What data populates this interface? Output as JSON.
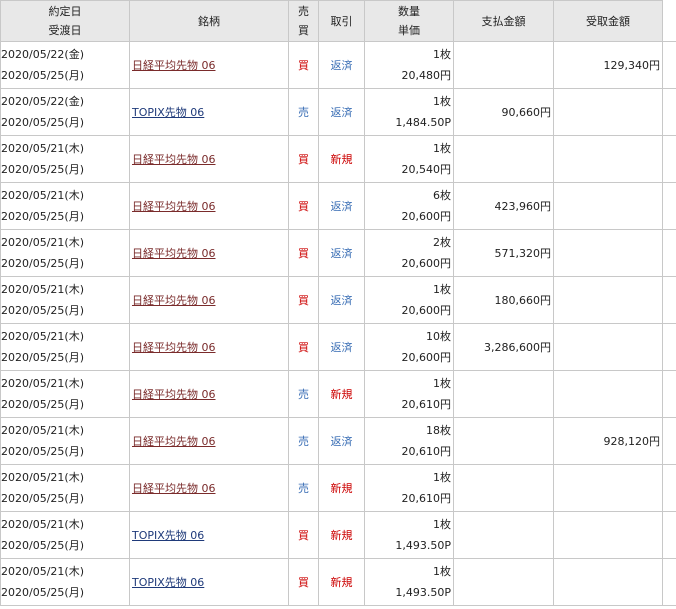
{
  "headers": {
    "date1": "約定日",
    "date2": "受渡日",
    "name": "銘柄",
    "side1": "売",
    "side2": "買",
    "trade": "取引",
    "qty1": "数量",
    "qty2": "単価",
    "pay": "支払金額",
    "receive": "受取金額"
  },
  "rows": [
    {
      "trade_date": "2020/05/22(金)",
      "settle_date": "2020/05/25(月)",
      "name": "日経平均先物 06",
      "side": "買",
      "trade": "返済",
      "qty": "1枚",
      "price": "20,480円",
      "pay": "",
      "receive": "129,340円"
    },
    {
      "trade_date": "2020/05/22(金)",
      "settle_date": "2020/05/25(月)",
      "name": "TOPIX先物 06",
      "side": "売",
      "trade": "返済",
      "qty": "1枚",
      "price": "1,484.50P",
      "pay": "90,660円",
      "receive": ""
    },
    {
      "trade_date": "2020/05/21(木)",
      "settle_date": "2020/05/25(月)",
      "name": "日経平均先物 06",
      "side": "買",
      "trade": "新規",
      "qty": "1枚",
      "price": "20,540円",
      "pay": "",
      "receive": ""
    },
    {
      "trade_date": "2020/05/21(木)",
      "settle_date": "2020/05/25(月)",
      "name": "日経平均先物 06",
      "side": "買",
      "trade": "返済",
      "qty": "6枚",
      "price": "20,600円",
      "pay": "423,960円",
      "receive": ""
    },
    {
      "trade_date": "2020/05/21(木)",
      "settle_date": "2020/05/25(月)",
      "name": "日経平均先物 06",
      "side": "買",
      "trade": "返済",
      "qty": "2枚",
      "price": "20,600円",
      "pay": "571,320円",
      "receive": ""
    },
    {
      "trade_date": "2020/05/21(木)",
      "settle_date": "2020/05/25(月)",
      "name": "日経平均先物 06",
      "side": "買",
      "trade": "返済",
      "qty": "1枚",
      "price": "20,600円",
      "pay": "180,660円",
      "receive": ""
    },
    {
      "trade_date": "2020/05/21(木)",
      "settle_date": "2020/05/25(月)",
      "name": "日経平均先物 06",
      "side": "買",
      "trade": "返済",
      "qty": "10枚",
      "price": "20,600円",
      "pay": "3,286,600円",
      "receive": ""
    },
    {
      "trade_date": "2020/05/21(木)",
      "settle_date": "2020/05/25(月)",
      "name": "日経平均先物 06",
      "side": "売",
      "trade": "新規",
      "qty": "1枚",
      "price": "20,610円",
      "pay": "",
      "receive": ""
    },
    {
      "trade_date": "2020/05/21(木)",
      "settle_date": "2020/05/25(月)",
      "name": "日経平均先物 06",
      "side": "売",
      "trade": "返済",
      "qty": "18枚",
      "price": "20,610円",
      "pay": "",
      "receive": "928,120円"
    },
    {
      "trade_date": "2020/05/21(木)",
      "settle_date": "2020/05/25(月)",
      "name": "日経平均先物 06",
      "side": "売",
      "trade": "新規",
      "qty": "1枚",
      "price": "20,610円",
      "pay": "",
      "receive": ""
    },
    {
      "trade_date": "2020/05/21(木)",
      "settle_date": "2020/05/25(月)",
      "name": "TOPIX先物 06",
      "side": "買",
      "trade": "新規",
      "qty": "1枚",
      "price": "1,493.50P",
      "pay": "",
      "receive": ""
    },
    {
      "trade_date": "2020/05/21(木)",
      "settle_date": "2020/05/25(月)",
      "name": "TOPIX先物 06",
      "side": "買",
      "trade": "新規",
      "qty": "1枚",
      "price": "1,493.50P",
      "pay": "",
      "receive": ""
    }
  ]
}
